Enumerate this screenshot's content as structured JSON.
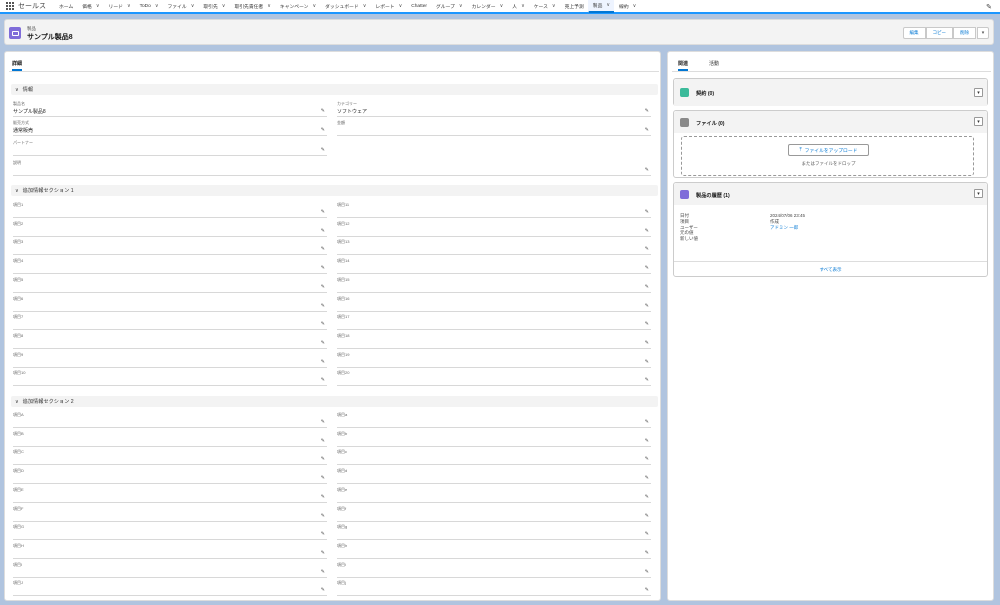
{
  "nav": {
    "app_name": "セールス",
    "items": [
      {
        "label": "ホーム",
        "chevron": false
      },
      {
        "label": "価格",
        "chevron": true
      },
      {
        "label": "リード",
        "chevron": true
      },
      {
        "label": "ToDo",
        "chevron": true
      },
      {
        "label": "ファイル",
        "chevron": true
      },
      {
        "label": "取引先",
        "chevron": true
      },
      {
        "label": "取引先責任者",
        "chevron": true
      },
      {
        "label": "キャンペーン",
        "chevron": true
      },
      {
        "label": "ダッシュボード",
        "chevron": true
      },
      {
        "label": "レポート",
        "chevron": true
      },
      {
        "label": "Chatter",
        "chevron": false
      },
      {
        "label": "グループ",
        "chevron": true
      },
      {
        "label": "カレンダー",
        "chevron": true
      },
      {
        "label": "人",
        "chevron": true
      },
      {
        "label": "ケース",
        "chevron": true
      },
      {
        "label": "売上予測",
        "chevron": false
      },
      {
        "label": "製品",
        "chevron": true,
        "active": true
      },
      {
        "label": "線約",
        "chevron": true
      }
    ]
  },
  "header": {
    "object_type": "製品",
    "title": "サンプル製品8",
    "buttons": [
      "編集",
      "コピー",
      "削除"
    ]
  },
  "left": {
    "tab": "詳細",
    "sections": {
      "info": "情報",
      "extra1": "追加情報セクション 1",
      "extra2": "追加情報セクション 2"
    },
    "info_fields": [
      {
        "label": "製品名",
        "value": "サンプル製品8"
      },
      {
        "label": "カテゴリー",
        "value": "ソフトウェア"
      },
      {
        "label": "販売方式",
        "value": "通常販売"
      },
      {
        "label": "金額",
        "value": ""
      },
      {
        "label": "パートナー",
        "value": ""
      },
      {
        "label": "説明",
        "value": ""
      }
    ],
    "section1_left": [
      "項目1",
      "項目2",
      "項目3",
      "項目4",
      "項目5",
      "項目6",
      "項目7",
      "項目8",
      "項目9",
      "項目10"
    ],
    "section1_right": [
      "項目11",
      "項目12",
      "項目13",
      "項目14",
      "項目15",
      "項目16",
      "項目17",
      "項目18",
      "項目19",
      "項目20"
    ],
    "section2_left": [
      "項目A",
      "項目B",
      "項目C",
      "項目D",
      "項目E",
      "項目F",
      "項目G",
      "項目H",
      "項目I",
      "項目J"
    ],
    "section2_right": [
      "項目a",
      "項目b",
      "項目c",
      "項目d",
      "項目e",
      "項目f",
      "項目g",
      "項目h",
      "項目i",
      "項目j"
    ]
  },
  "right": {
    "tabs": [
      "関連",
      "活動"
    ],
    "contracts": {
      "title": "契約 (0)",
      "icon": "contract-icon",
      "color": "#3bba9a"
    },
    "files": {
      "title": "ファイル (0)",
      "icon": "file-icon",
      "color": "#8a8a8a",
      "upload": "ファイルをアップロード",
      "drop": "またはファイルをドロップ"
    },
    "history": {
      "title": "製品の履歴 (1)",
      "icon": "product-icon",
      "color": "#7f6cd9",
      "rows": [
        {
          "k": "日付",
          "v": "2024/07/06 23:45"
        },
        {
          "k": "項目",
          "v": "作成"
        },
        {
          "k": "ユーザー",
          "v": "アドミン 一郎"
        },
        {
          "k": "元の値",
          "v": ""
        },
        {
          "k": "新しい値",
          "v": ""
        }
      ],
      "view_all": "すべて表示"
    }
  },
  "colors": {
    "accent": "#0176d3",
    "background": "#b0c4df"
  }
}
